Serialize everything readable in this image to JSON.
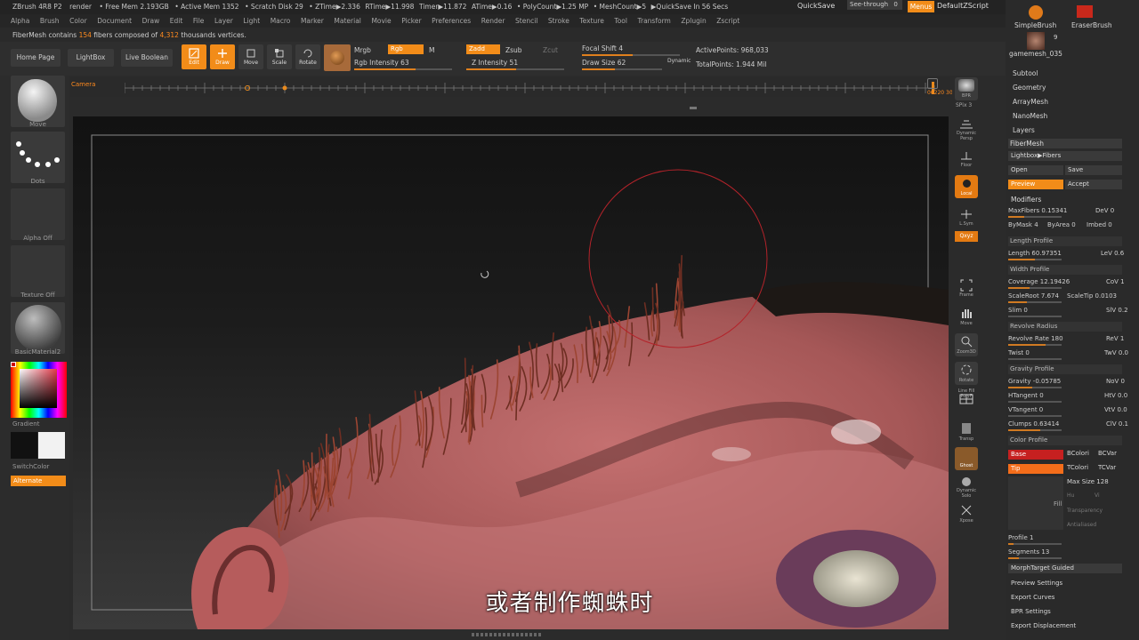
{
  "app": {
    "title": "ZBrush 4R8 P2",
    "doc": "render",
    "free_mem": "• Free Mem 2.193GB",
    "active_mem": "• Active Mem 1352",
    "scratch": "• Scratch Disk 29",
    "ztime": "• ZTime▶2.336",
    "rtime": "RTime▶11.998",
    "timer": "Timer▶11.872",
    "atime": "ATime▶0.16",
    "polycount": "• PolyCount▶1.25 MP",
    "meshcount": "• MeshCount▶5",
    "quicksave_in": "▶QuickSave In 56 Secs",
    "quicksave": "QuickSave",
    "see_through": "See-through",
    "see_through_val": "0",
    "menus": "Menus",
    "script": "DefaultZScript"
  },
  "menu": [
    "Alpha",
    "Brush",
    "Color",
    "Document",
    "Draw",
    "Edit",
    "File",
    "Layer",
    "Light",
    "Macro",
    "Marker",
    "Material",
    "Movie",
    "Picker",
    "Preferences",
    "Render",
    "Stencil",
    "Stroke",
    "Texture",
    "Tool",
    "Transform",
    "Zplugin",
    "Zscript"
  ],
  "info": {
    "prefix": "FiberMesh contains",
    "fibers": "154",
    "mid": "fibers composed of",
    "verts": "4,312",
    "suffix": "thousands vertices."
  },
  "toolbar": {
    "home": "Home Page",
    "lightbox": "LightBox",
    "live_boolean": "Live Boolean",
    "edit": "Edit",
    "draw": "Draw",
    "move": "Move",
    "scale": "Scale",
    "rotate": "Rotate",
    "mrgb": "Mrgb",
    "rgb": "Rgb",
    "m": "M",
    "rgb_intensity": "Rgb Intensity 63",
    "zadd": "Zadd",
    "zsub": "Zsub",
    "zcut": "Zcut",
    "z_intensity": "Z Intensity 51",
    "focal_shift": "Focal Shift 4",
    "draw_size": "Draw Size 62",
    "dynamic": "Dynamic",
    "active_points": "ActivePoints: 968,033",
    "total_points": "TotalPoints: 1.944 Mil",
    "rgb_intensity_value": 63,
    "z_intensity_value": 51,
    "focal_shift_value": 4,
    "draw_size_value": 62
  },
  "timeline": {
    "label": "Camera",
    "frame": "00220",
    "fps": "30"
  },
  "left": {
    "move": "Move",
    "dots": "Dots",
    "alpha_off": "Alpha Off",
    "texture_off": "Texture Off",
    "material": "BasicMaterial2",
    "gradient": "Gradient",
    "switch_color": "SwitchColor",
    "alternate": "Alternate"
  },
  "rshelf": [
    "BPR",
    "SPix 3",
    "Dynamic Persp",
    "Floor",
    "Local",
    "L.Sym",
    "Qxyz",
    "Frame",
    "Move",
    "Zoom3D",
    "Rotate",
    "Line Fill PolyF",
    "Transp",
    "Ghost",
    "Dynamic Solo",
    "Xpose"
  ],
  "palette": {
    "simple_brush": "SimpleBrush",
    "eraser_brush": "EraserBrush",
    "count": "9",
    "gamemesh": "gamemesh_035",
    "subtool": "Subtool",
    "geometry": "Geometry",
    "arraymesh": "ArrayMesh",
    "nanomesh": "NanoMesh",
    "layers": "Layers",
    "fibermesh": "FiberMesh",
    "lightbox_fibers": "Lightbox▶Fibers",
    "open": "Open",
    "save": "Save",
    "preview": "Preview",
    "accept": "Accept",
    "modifiers": "Modifiers",
    "max_fibers": "MaxFibers 0.15341",
    "dev": "DeV 0",
    "by_mask": "ByMask 4",
    "by_area": "ByArea 0",
    "imbed": "Imbed 0",
    "length_profile": "Length Profile",
    "length": "Length 60.97351",
    "lev": "LeV 0.6",
    "width_profile": "Width Profile",
    "coverage": "Coverage 12.19426",
    "cov": "CoV 1",
    "scale_root": "ScaleRoot 7.674",
    "scale_tip": "ScaleTip 0.0103",
    "slim": "Slim 0",
    "slv": "SlV 0.2",
    "revolve_radius": "Revolve Radius",
    "revolve_rate": "Revolve Rate 180",
    "rev": "ReV 1",
    "twist": "Twist 0",
    "twv": "TwV 0.0",
    "gravity_profile": "Gravity Profile",
    "gravity": "Gravity -0.05785",
    "nov": "NoV 0",
    "htangent": "HTangent 0",
    "htv": "HtV 0.0",
    "vtangent": "VTangent 0",
    "vtv": "VtV 0.0",
    "clumps": "Clumps 0.63414",
    "clv": "ClV 0.1",
    "color_profile": "Color Profile",
    "base": "Base",
    "bcolor": "BColori",
    "bcvar": "BCVar",
    "tip": "Tip",
    "tcolor": "TColori",
    "tcvar": "TCVar",
    "max_size": "Max Size 128",
    "hu": "Hu",
    "vi": "Vi",
    "fill": "Fill",
    "transparency": "Transparency",
    "antialiased": "Antialiased",
    "profile": "Profile 1",
    "segments": "Segments 13",
    "morph": "MorphTarget Guided",
    "preview_settings": "Preview Settings",
    "export_curves": "Export Curves",
    "bpr_settings": "BPR Settings",
    "export_displacement": "Export Displacement"
  },
  "subtitle": "或者制作蜘蛛时",
  "colors": {
    "accent": "#f28c19",
    "base": "#c62020",
    "tip": "#f46d1a"
  }
}
